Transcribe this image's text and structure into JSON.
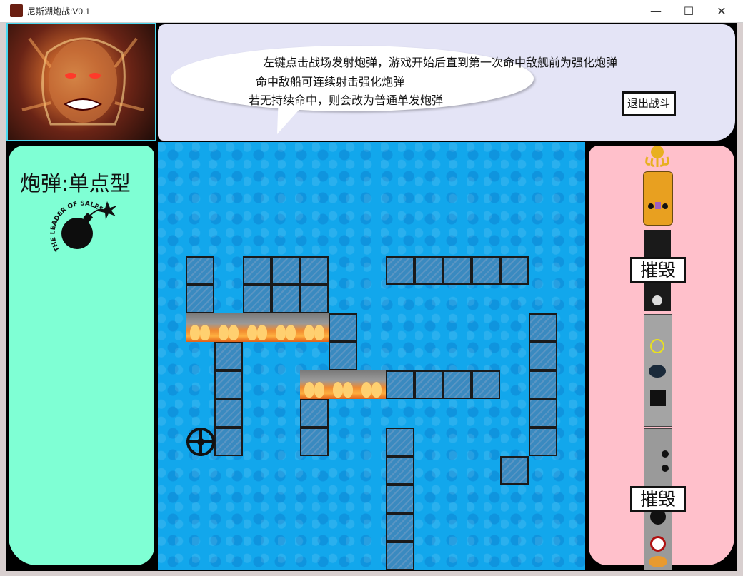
{
  "window": {
    "title": "尼斯湖炮战:V0.1",
    "controls": {
      "minimize": "—",
      "maximize": "☐",
      "close": "✕"
    }
  },
  "dialog": {
    "lines": [
      "左键点击战场发射炮弹，游戏开始后直到第一次命中敌舰前为强化炮弹",
      "命中敌船可连续射击强化炮弹",
      "若无持续命中，则会改为普通单发炮弹"
    ],
    "exit_button": "退出战斗"
  },
  "left_panel": {
    "ammo_label": "炮弹:单点型",
    "bomb_text": "THE LEADER OF SALES"
  },
  "right_panel": {
    "ships": [
      {
        "name": "octopus",
        "status": ""
      },
      {
        "name": "gold-ship",
        "status": ""
      },
      {
        "name": "black-ship",
        "status": "摧毁"
      },
      {
        "name": "grey-battleship",
        "status": ""
      },
      {
        "name": "rocket-ship",
        "status": "摧毁"
      }
    ]
  },
  "colors": {
    "sea": "#12a7ec",
    "left_panel": "#7fffd4",
    "right_panel": "#ffc0cb",
    "dialog_panel": "#e4e4f6",
    "portrait_border": "#4ad8f0"
  }
}
